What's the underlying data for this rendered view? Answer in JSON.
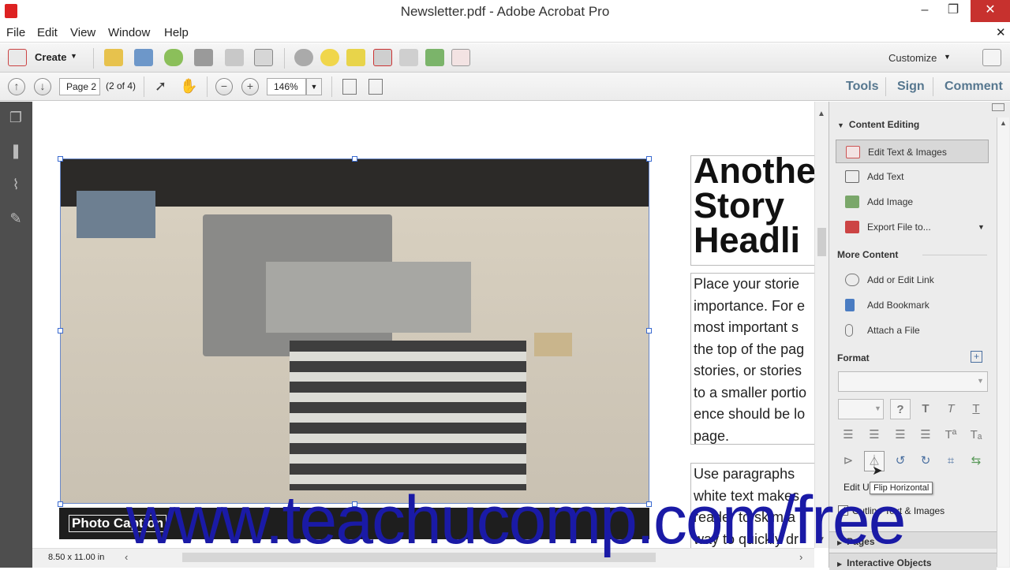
{
  "window": {
    "title": "Newsletter.pdf - Adobe Acrobat Pro"
  },
  "menu": [
    "File",
    "Edit",
    "View",
    "Window",
    "Help"
  ],
  "toolbar": {
    "create_label": "Create",
    "customize_label": "Customize"
  },
  "nav": {
    "page_field": "Page 2",
    "page_count": "(2 of 4)",
    "zoom": "146%"
  },
  "tabs": {
    "tools": "Tools",
    "sign": "Sign",
    "comment": "Comment"
  },
  "document": {
    "caption": "Photo Caption",
    "headline": [
      "Anothe",
      "Story",
      "Headli"
    ],
    "body1": [
      "Place your storie",
      "importance. For e",
      "most important s",
      "the top of the pag",
      "stories, or stories",
      "to a smaller portio",
      "ence should be lo",
      "page."
    ],
    "body2": [
      "Use paragraphs",
      "white text makes",
      "reader to skim a",
      "way to quickly dr"
    ],
    "page_size": "8.50 x 11.00 in"
  },
  "panel": {
    "content_editing": "Content Editing",
    "items": [
      "Edit Text & Images",
      "Add Text",
      "Add Image",
      "Export File to..."
    ],
    "more_content": "More Content",
    "more_items": [
      "Add or Edit Link",
      "Add Bookmark",
      "Attach a File"
    ],
    "format": "Format",
    "tooltip": "Flip Horizontal",
    "edit_using": "Edit Us",
    "outline_label": "Outline Text & Images",
    "pages": "Pages",
    "interactive_objects": "Interactive Objects"
  },
  "watermark": "www.teachucomp.com/free",
  "colors": {
    "accent": "#56778f",
    "close": "#c7312e",
    "watermark": "#1a1aa6"
  }
}
